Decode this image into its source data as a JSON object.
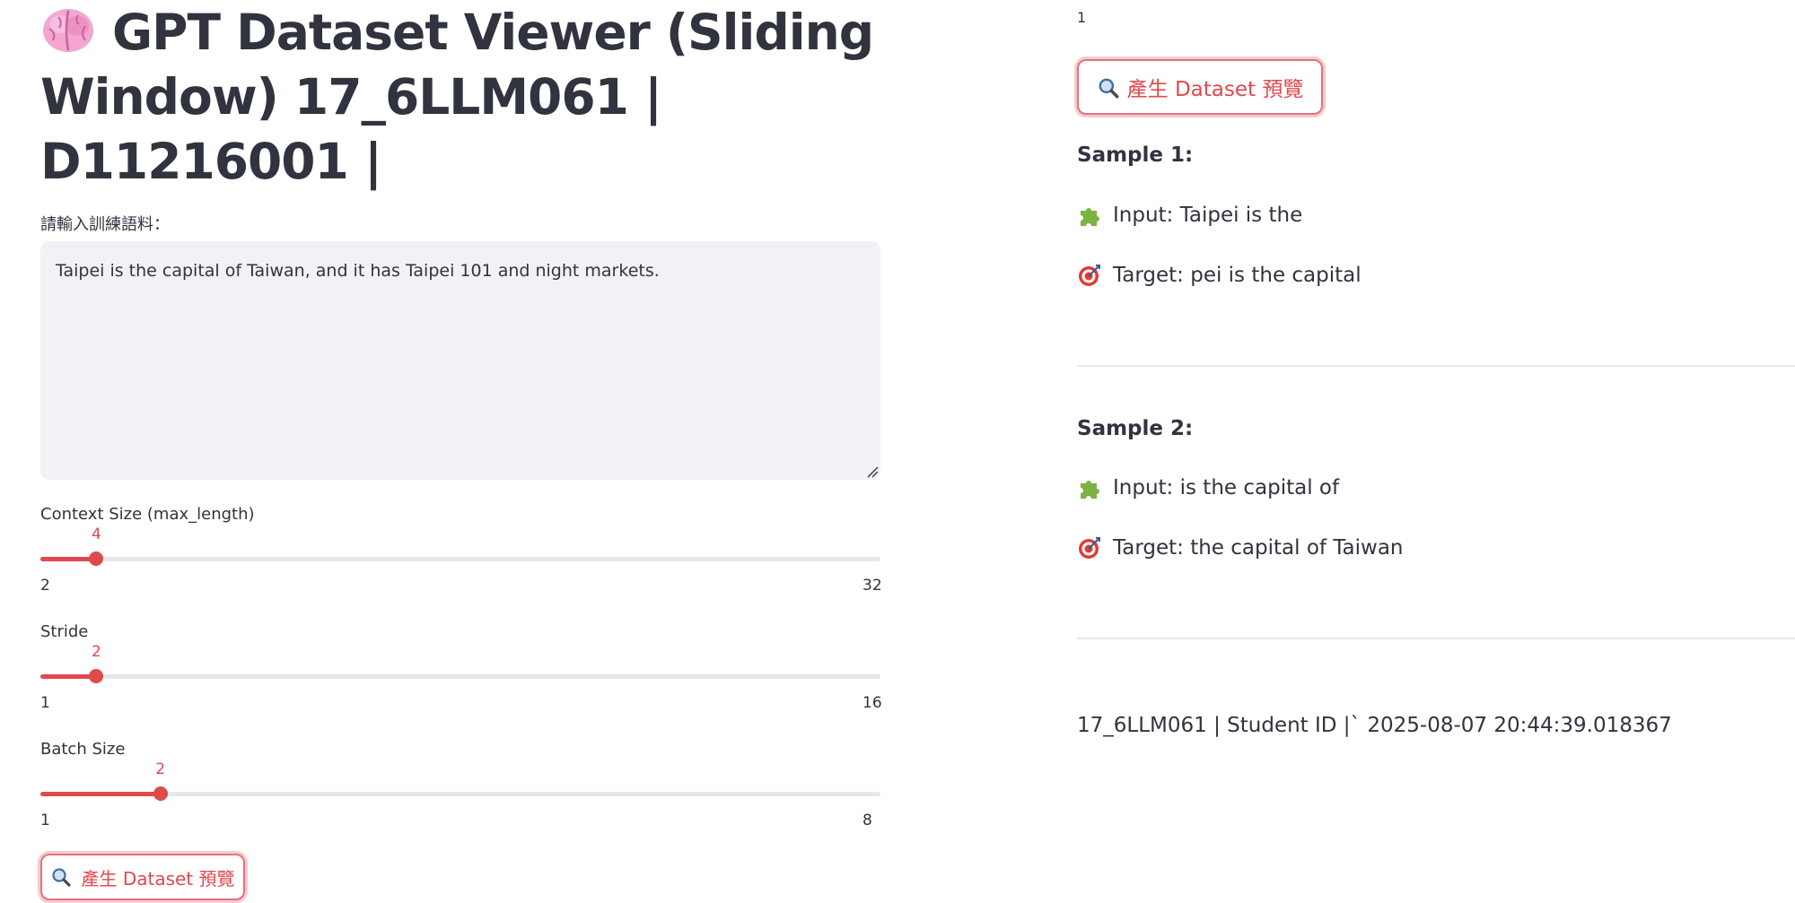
{
  "header": {
    "title": "GPT Dataset Viewer (Sliding Window) 17_6LLM061 | D11216001 |",
    "icon": "brain-icon"
  },
  "input": {
    "label": "請輸入訓練語料：",
    "value": "Taipei is the capital of Taiwan, and it has Taipei 101 and night markets."
  },
  "sliders": [
    {
      "label": "Context Size (max_length)",
      "value": 4,
      "min": 2,
      "max": 32
    },
    {
      "label": "Stride",
      "value": 2,
      "min": 1,
      "max": 16
    },
    {
      "label": "Batch Size",
      "value": 2,
      "min": 1,
      "max": 8
    }
  ],
  "generate_button": {
    "label": "產生 Dataset 預覽",
    "icon": "magnifier-icon"
  },
  "results": {
    "top_fragment": "1",
    "samples": [
      {
        "title": "Sample 1:",
        "input": "Input: Taipei is the",
        "target": "Target: pei is the capital"
      },
      {
        "title": "Sample 2:",
        "input": "Input: is the capital of",
        "target": "Target: the capital of Taiwan"
      }
    ],
    "footer": "17_6LLM061 | Student ID |` 2025-08-07 20:44:39.018367"
  },
  "colors": {
    "accent": "#e0484e",
    "text": "#31333f",
    "input_bg": "#f0f2f6",
    "track": "#e6e7ea"
  }
}
